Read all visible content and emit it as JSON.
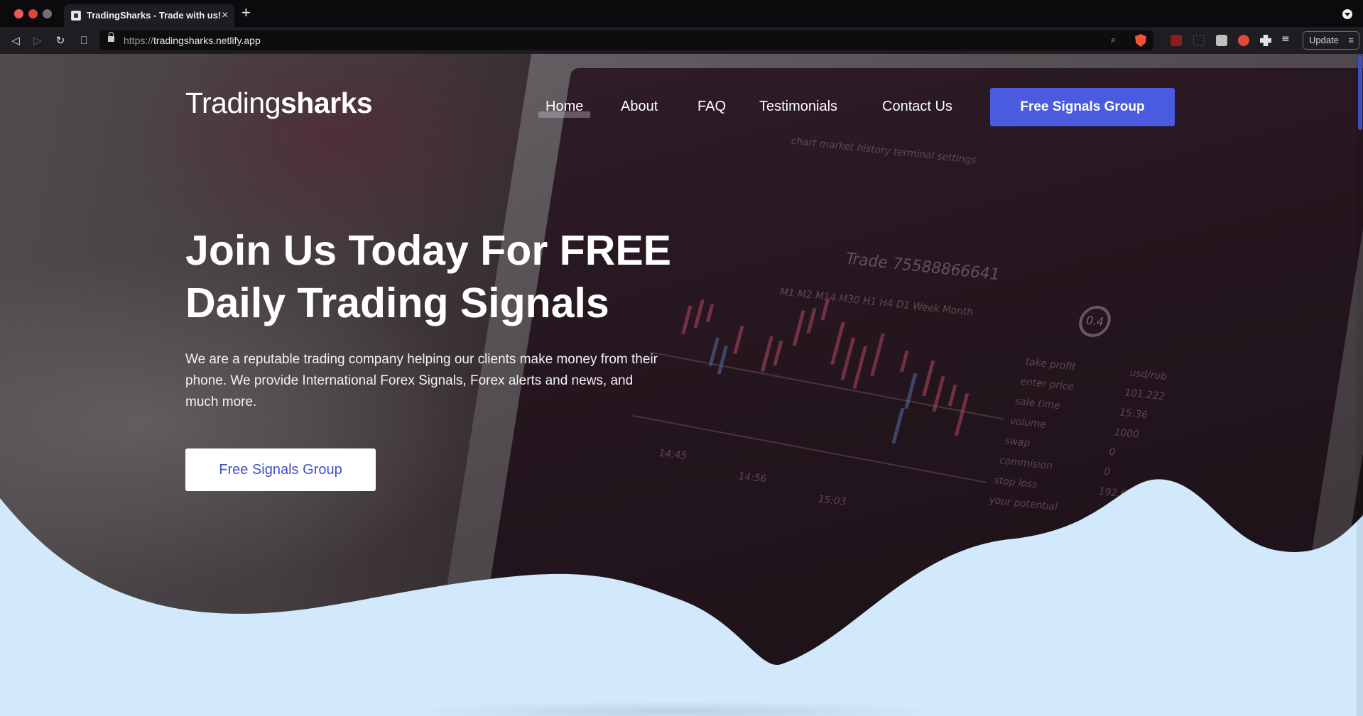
{
  "browser": {
    "tab_title": "TradingSharks - Trade with us!",
    "tab_close": "×",
    "new_tab": "+",
    "url_scheme": "https://",
    "url_host": "tradingsharks.netlify.app",
    "update_label": "Update",
    "icons": {
      "back": "◁",
      "forward": "▷",
      "reload": "↻",
      "bookmark": "⎕",
      "zoom": "⌕",
      "menu": "≡",
      "playlist": "≡"
    }
  },
  "site": {
    "brand_light": "Trading",
    "brand_bold": "sharks",
    "nav": {
      "home": "Home",
      "about": "About",
      "faq": "FAQ",
      "testimonials": "Testimonials",
      "contact": "Contact Us"
    },
    "header_cta": "Free Signals Group",
    "hero": {
      "headline_line1": "Join Us Today For FREE",
      "headline_line2": "Daily Trading Signals",
      "description": "We are a reputable trading company helping our clients make money from their phone. We provide International Forex Signals, Forex alerts and news, and much more.",
      "cta": "Free Signals Group"
    },
    "colors": {
      "accent": "#4b5bdf",
      "wave": "#d2e9fc",
      "cta_text": "#3f4fc9"
    }
  },
  "background_screen": {
    "trade_label": "Trade 75588866641",
    "timeframes": "M1   M2   M14   M30   H1   H4   D1   Week   Month",
    "menu": "chart      market      history      terminal      settings",
    "gauge": "0.4",
    "stats": [
      "take profit",
      "enter price",
      "sale time",
      "volume",
      "swap",
      "commision",
      "stop loss",
      "your potential"
    ],
    "stat_values": [
      "usd/rub",
      "101.222",
      "15:36",
      "1000",
      "0",
      "0",
      "192.631"
    ],
    "times": [
      "14:45",
      "14:56",
      "15:03"
    ]
  }
}
